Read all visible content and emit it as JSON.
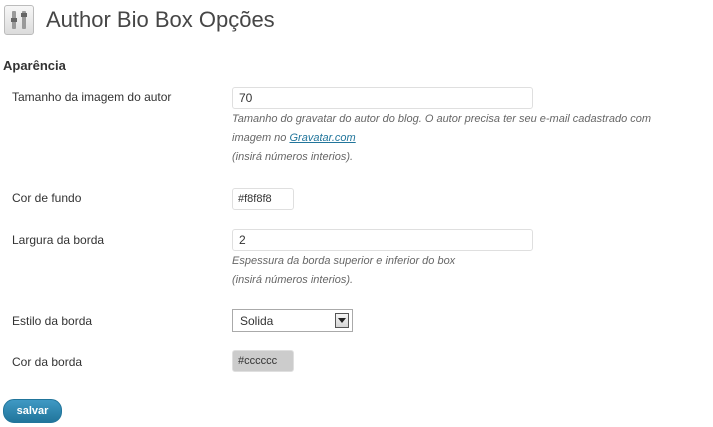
{
  "page": {
    "title": "Author Bio Box Opções"
  },
  "section": {
    "title": "Aparência"
  },
  "fields": {
    "image_size": {
      "label": "Tamanho da imagem do autor",
      "value": "70",
      "desc_line1": "Tamanho do gravatar do autor do blog. O autor precisa ter seu e-mail cadastrado com",
      "desc_line2_prefix": "imagem no ",
      "desc_link": "Gravatar.com",
      "desc_line3": "(insirá números interios)."
    },
    "background_color": {
      "label": "Cor de fundo",
      "value": "#f8f8f8",
      "swatch": "#ffffff"
    },
    "border_width": {
      "label": "Largura da borda",
      "value": "2",
      "desc_line1": "Espessura da borda superior e inferior do box",
      "desc_line2": "(insirá números interios)."
    },
    "border_style": {
      "label": "Estilo da borda",
      "selected": "Solida"
    },
    "border_color": {
      "label": "Cor da borda",
      "value": "#cccccc",
      "swatch": "#cccccc"
    }
  },
  "actions": {
    "save_label": "salvar"
  },
  "colors": {
    "link": "#21759b",
    "button": "#21759b"
  },
  "icons": {
    "header": "settings-tools-icon",
    "select": "chevron-down-icon"
  }
}
